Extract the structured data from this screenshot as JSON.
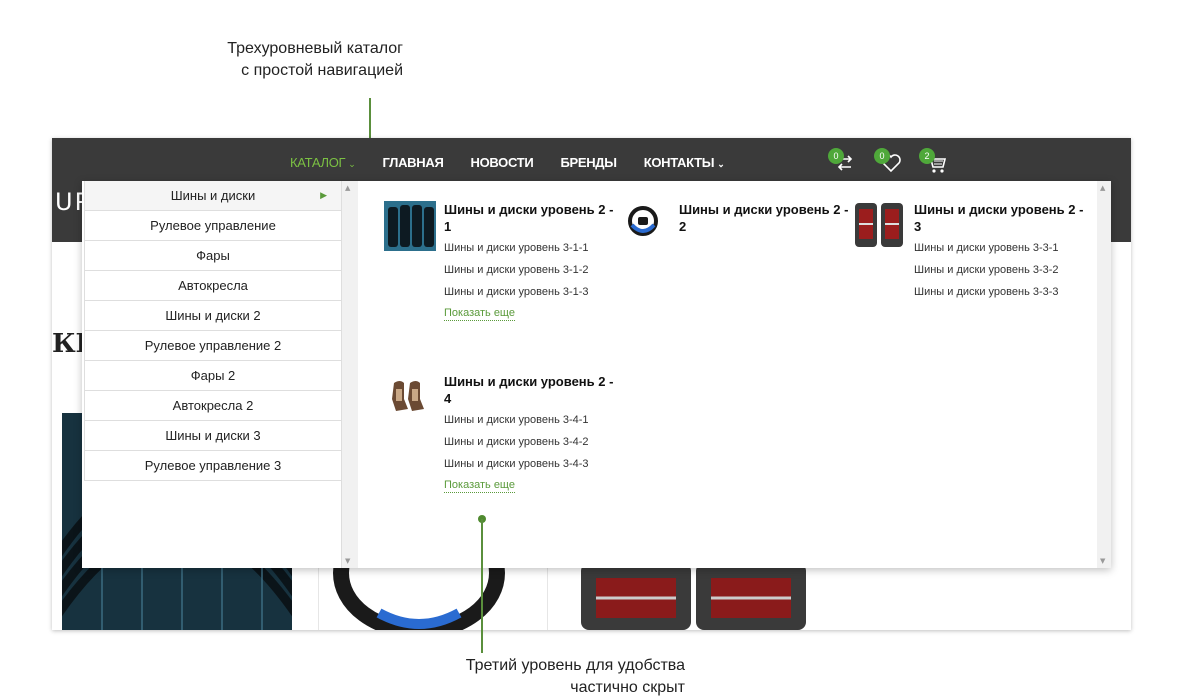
{
  "annotations": {
    "top_line1": "Трехуровневый каталог",
    "top_line2": "с простой навигацией",
    "bottom_line1": "Третий уровень для удобства",
    "bottom_line2": "частично скрыт"
  },
  "header": {
    "logo_fragment": "UP",
    "nav": [
      {
        "label": "КАТАЛОГ",
        "has_caret": true,
        "active": true
      },
      {
        "label": "ГЛАВНАЯ"
      },
      {
        "label": "НОВОСТИ"
      },
      {
        "label": "БРЕНДЫ"
      },
      {
        "label": "КОНТАКТЫ",
        "has_caret": true
      }
    ],
    "icons": [
      {
        "name": "compare-icon",
        "count": "0"
      },
      {
        "name": "wishlist-heart-icon",
        "count": "0"
      },
      {
        "name": "cart-icon",
        "count": "2"
      }
    ]
  },
  "page": {
    "heading_fragment": "КШ"
  },
  "catalog_menu": {
    "items": [
      "Шины и диски",
      "Рулевое управление",
      "Фары",
      "Автокресла",
      "Шины и диски 2",
      "Рулевое управление 2",
      "Фары 2",
      "Автокресла 2",
      "Шины и диски 3",
      "Рулевое управление 3"
    ],
    "active_index": 0
  },
  "subcategories": [
    {
      "title": "Шины и диски уровень 2 - 1",
      "thumb": "tires",
      "links": [
        "Шины и диски уровень 3-1-1",
        "Шины и диски уровень 3-1-2",
        "Шины и диски уровень 3-1-3"
      ],
      "more": "Показать еще"
    },
    {
      "title": "Шины и диски уровень 2 - 2",
      "thumb": "steering-wheel",
      "links": [],
      "more": ""
    },
    {
      "title": "Шины и диски уровень 2 - 3",
      "thumb": "tail-lights",
      "links": [
        "Шины и диски уровень 3-3-1",
        "Шины и диски уровень 3-3-2",
        "Шины и диски уровень 3-3-3"
      ],
      "more": ""
    },
    {
      "title": "Шины и диски уровень 2 - 4",
      "thumb": "car-seats",
      "links": [
        "Шины и диски уровень 3-4-1",
        "Шины и диски уровень 3-4-2",
        "Шины и диски уровень 3-4-3"
      ],
      "more": "Показать еще"
    }
  ],
  "colors": {
    "accent_green": "#5a9a3a",
    "header_bg": "#3a3a3a"
  }
}
